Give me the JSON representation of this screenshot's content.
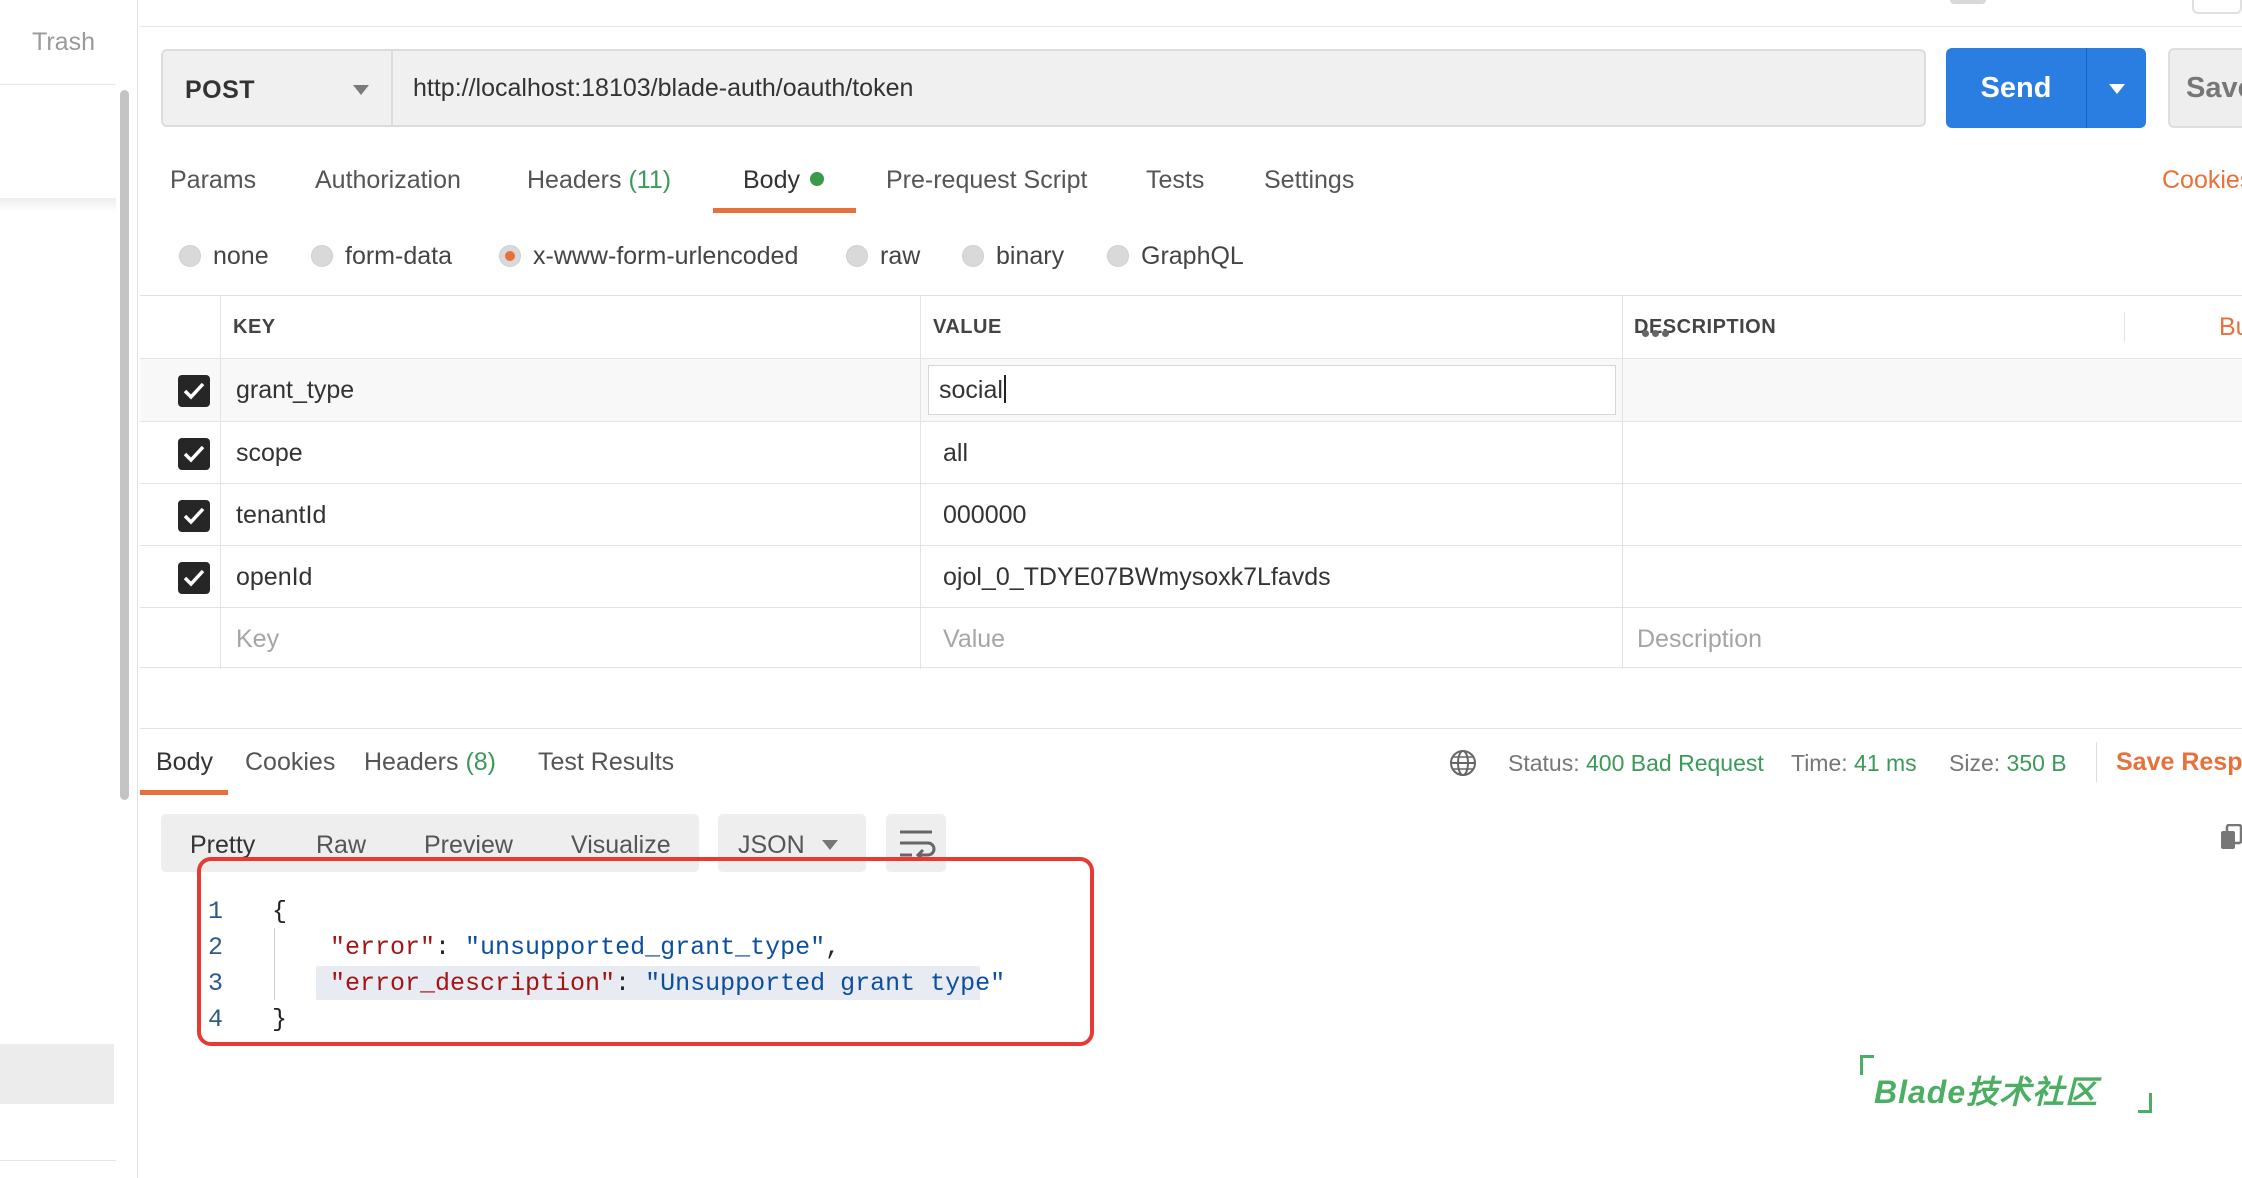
{
  "sidebar": {
    "trash_label": "Trash"
  },
  "request": {
    "method": "POST",
    "url": "http://localhost:18103/blade-auth/oauth/token",
    "send_label": "Send",
    "save_label": "Save"
  },
  "request_tabs": {
    "params": "Params",
    "authorization": "Authorization",
    "headers": "Headers",
    "headers_count": "(11)",
    "body": "Body",
    "pre_request": "Pre-request Script",
    "tests": "Tests",
    "settings": "Settings",
    "cookies": "Cookies",
    "active": "Body"
  },
  "body_types": {
    "none": "none",
    "form_data": "form-data",
    "urlencoded": "x-www-form-urlencoded",
    "raw": "raw",
    "binary": "binary",
    "graphql": "GraphQL",
    "selected": "x-www-form-urlencoded"
  },
  "params_table": {
    "headers": {
      "key": "KEY",
      "value": "VALUE",
      "description": "DESCRIPTION",
      "bulk_edit": "Bu"
    },
    "rows": [
      {
        "checked": true,
        "key": "grant_type",
        "value": "social",
        "description": ""
      },
      {
        "checked": true,
        "key": "scope",
        "value": "all",
        "description": ""
      },
      {
        "checked": true,
        "key": "tenantId",
        "value": "000000",
        "description": ""
      },
      {
        "checked": true,
        "key": "openId",
        "value": "ojol_0_TDYE07BWmysoxk7Lfavds",
        "description": ""
      }
    ],
    "placeholders": {
      "key": "Key",
      "value": "Value",
      "description": "Description"
    }
  },
  "response": {
    "tabs": {
      "body": "Body",
      "cookies": "Cookies",
      "headers": "Headers",
      "headers_count": "(8)",
      "test_results": "Test Results"
    },
    "status_label": "Status:",
    "status": "400 Bad Request",
    "time_label": "Time:",
    "time": "41 ms",
    "size_label": "Size:",
    "size": "350 B",
    "save_label": "Save Respo",
    "formats": {
      "pretty": "Pretty",
      "raw": "Raw",
      "preview": "Preview",
      "visualize": "Visualize"
    },
    "language": "JSON",
    "code": {
      "line_numbers": [
        "1",
        "2",
        "3",
        "4"
      ],
      "open_brace": "{",
      "close_brace": "}",
      "error_key": "\"error\"",
      "error_value": "\"unsupported_grant_type\"",
      "desc_key": "\"error_description\"",
      "desc_value": "\"Unsupported grant type\""
    }
  },
  "watermark": "Blade技术社区",
  "colors": {
    "accent": "#e8703a",
    "send_blue": "#2a7de1",
    "success_green": "#3b9a5a",
    "annotation_red": "#e63a32",
    "json_key": "#a31515",
    "json_string": "#0b4f9e"
  }
}
